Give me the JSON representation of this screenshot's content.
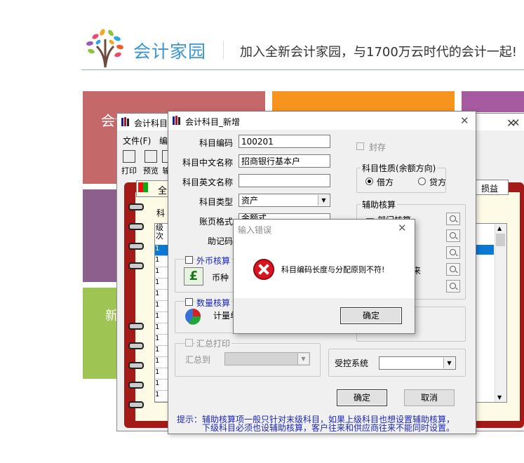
{
  "site": {
    "brand": "会计家园",
    "slogan": "加入全新会计家园，与1700万云时代的会计一起!"
  },
  "tiles": {
    "red_label": "会计家园",
    "purple_label": "",
    "green_label": "新",
    "colors": {
      "red": "#c4686a",
      "orange": "#f7941d",
      "purple": "#8c5f8c",
      "green": "#9ec454",
      "magenta": "#a65aa0"
    }
  },
  "back_window": {
    "title": "会计科目",
    "menu": [
      "文件(F)",
      "编"
    ],
    "tools": [
      "打印",
      "预览",
      "输"
    ],
    "tab_all": "全",
    "tab_right": "损益",
    "col_header_1": "级",
    "col_header_2": "次",
    "col_left_label": "科",
    "rows": [
      "1",
      "1",
      "1",
      "1",
      "1",
      "1",
      "1",
      "1",
      "1",
      "1",
      "1",
      "1",
      "1",
      "1",
      "1"
    ]
  },
  "dialog": {
    "title": "会计科目_新增",
    "code_label": "科目编码",
    "code_value": "100201",
    "cn_name_label": "科目中文名称",
    "cn_name_value": "招商银行基本户",
    "en_name_label": "科目英文名称",
    "en_name_value": "",
    "type_label": "科目类型",
    "type_value": "资产",
    "format_label": "账页格式",
    "format_value": "金额式",
    "mnemonic_label": "助记码",
    "sealed_label": "封存",
    "nature_group": "科目性质(余额方向)",
    "debit_label": "借方",
    "credit_label": "贷方",
    "aux_group": "辅助核算",
    "aux_dept": "部门核算",
    "aux_partial": "来",
    "fx_label": "外币核算",
    "currency_label": "币种",
    "qty_label": "数量核算",
    "unit_label": "计量单",
    "summary_label": "汇总打印",
    "summary_to_label": "汇总到",
    "controlled_label": "受控系统",
    "ok_label": "确定",
    "cancel_label": "取消",
    "hint_line1": "提示：辅助核算项一般只针对末级科目，如果上级科目也想设置辅助核算，",
    "hint_line2": "下级科目必须也设辅助核算，客户往来和供应商往来不能同时设置。"
  },
  "error": {
    "title": "输入错误",
    "message": "科目编码长度与分配原则不符!",
    "ok_label": "确定"
  },
  "colors": {
    "hint": "#1d27b9",
    "accent_brand": "#3b95d8",
    "book": "#a41a16",
    "error_red": "#d7161d"
  }
}
